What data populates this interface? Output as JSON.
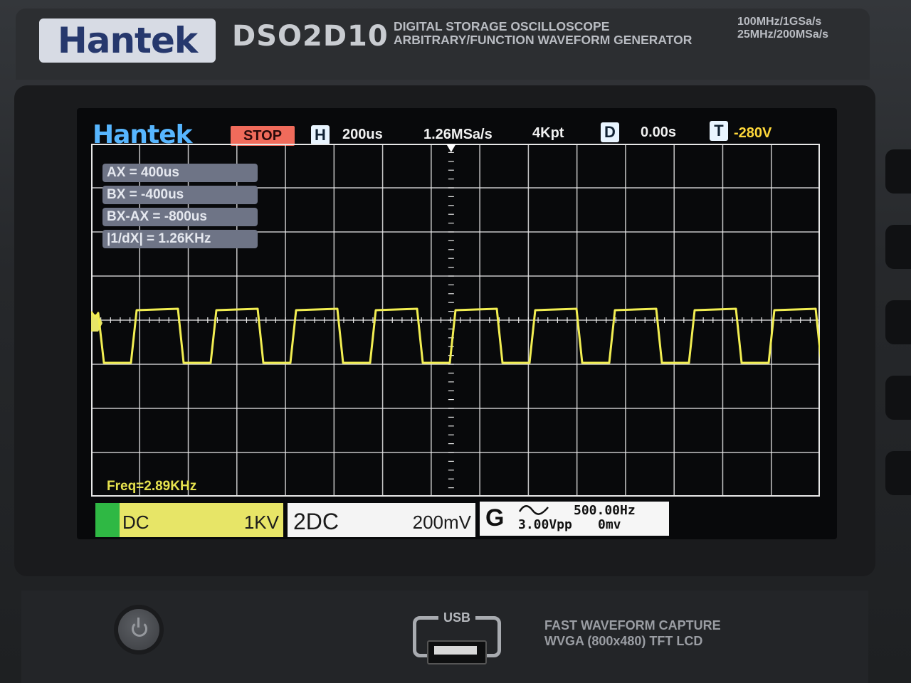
{
  "header": {
    "brand": "Hantek",
    "model": "DSO2D10",
    "desc_line1": "DIGITAL STORAGE OSCILLOSCOPE",
    "desc_line2": "ARBITRARY/FUNCTION WAVEFORM GENERATOR",
    "spec_line1": "100MHz/1GSa/s",
    "spec_line2": "25MHz/200MSa/s"
  },
  "screen": {
    "logo": "Hantek",
    "run_state": "STOP",
    "h_tag": "H",
    "timebase": "200us",
    "sample_rate": "1.26MSa/s",
    "memory_depth": "4Kpt",
    "d_tag": "D",
    "delay": "0.00s",
    "t_tag": "T",
    "trigger_level": "-280V"
  },
  "cursors": {
    "ax": "AX      = 400us",
    "bx": "BX      = -400us",
    "dx": "BX-AX = -800us",
    "inv_dx": "|1/dX|   = 1.26KHz"
  },
  "measurement": {
    "freq": "Freq=2.89KHz"
  },
  "channels": {
    "ch1_coupling": "DC",
    "ch1_scale": "1KV",
    "ch2_label": "2DC",
    "ch2_scale": "200mV"
  },
  "generator": {
    "label": "G",
    "frequency": "500.00Hz",
    "amplitude": "3.00Vpp",
    "offset": "0mv"
  },
  "front_panel": {
    "usb_label": "USB",
    "lcd_line1": "FAST WAVEFORM CAPTURE",
    "lcd_line2": "WVGA (800x480) TFT LCD"
  },
  "colors": {
    "trace": "#f2ee52",
    "stop_badge": "#f06b5b",
    "screen_logo": "#57b6ff",
    "ch1_badge": "#e7e567",
    "grid": "#e8e8e8"
  }
}
